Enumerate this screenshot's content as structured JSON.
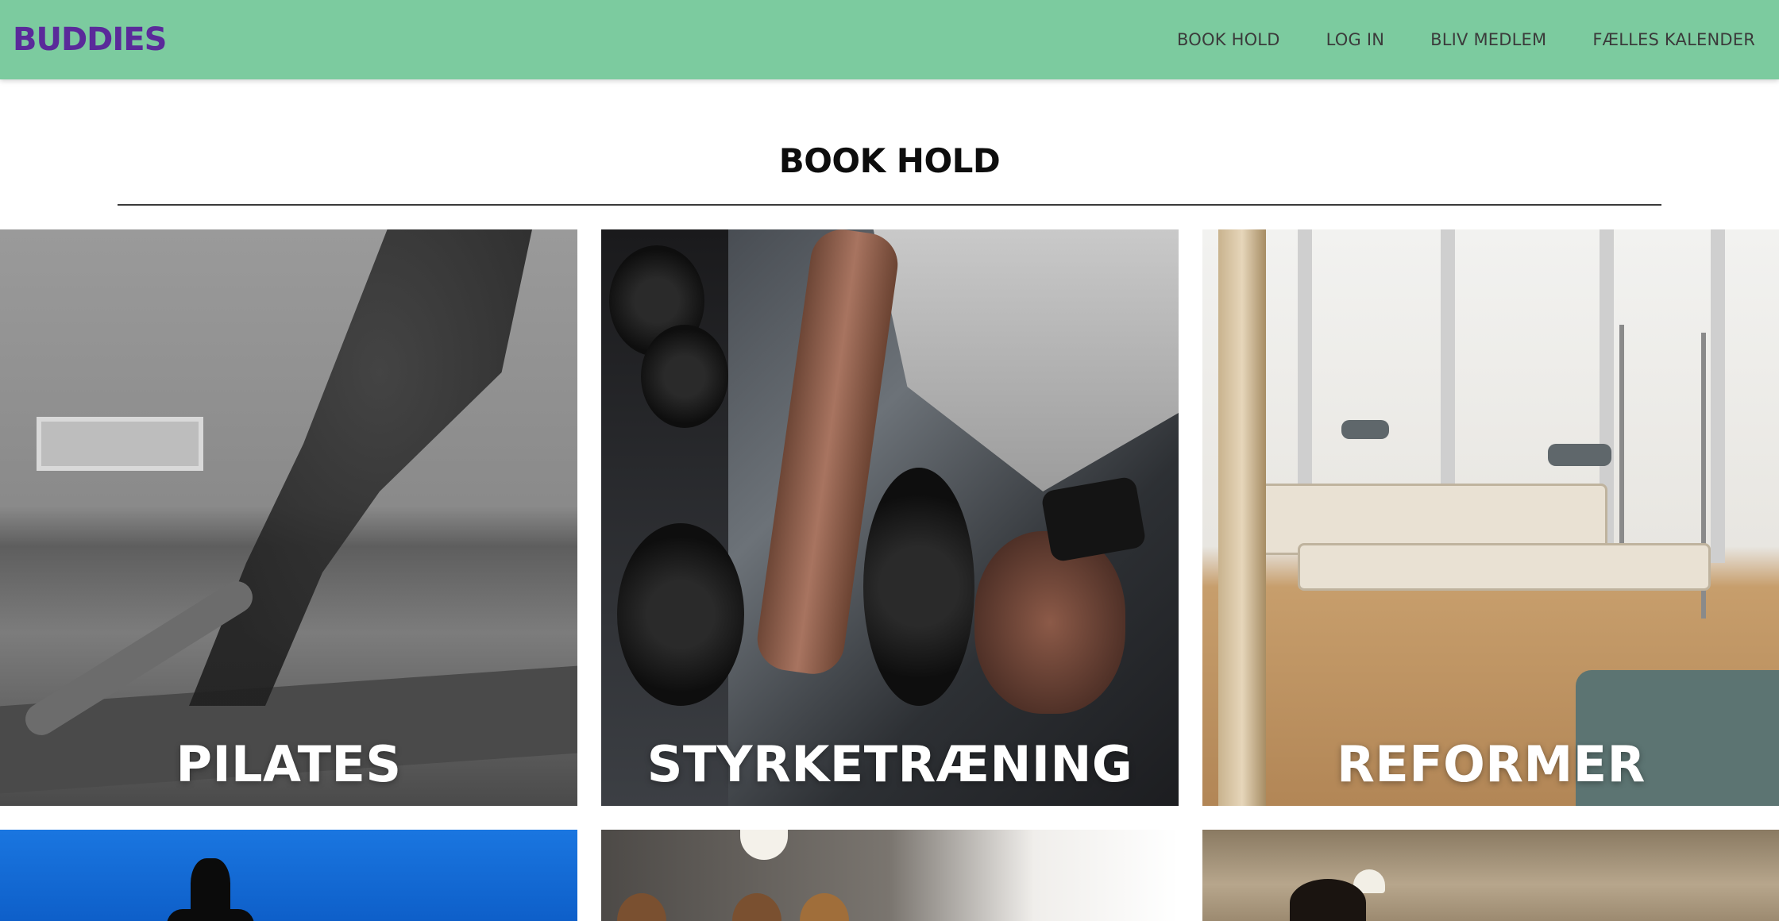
{
  "header": {
    "logo": "BUDDIES",
    "nav": [
      {
        "label": "BOOK HOLD"
      },
      {
        "label": "LOG IN"
      },
      {
        "label": "BLIV MEDLEM"
      },
      {
        "label": "FÆLLES KALENDER"
      }
    ],
    "background_color": "#7ccb9f",
    "logo_color": "#5a2a9a"
  },
  "main": {
    "title": "BOOK HOLD",
    "classes": [
      {
        "label": "PILATES",
        "image": "pilates-photo"
      },
      {
        "label": "STYRKETRÆNING",
        "image": "strength-training-photo"
      },
      {
        "label": "REFORMER",
        "image": "reformer-photo"
      },
      {
        "label": "",
        "image": "sky-silhouette-photo"
      },
      {
        "label": "",
        "image": "group-class-photo"
      },
      {
        "label": "",
        "image": "studio-person-photo"
      }
    ]
  }
}
